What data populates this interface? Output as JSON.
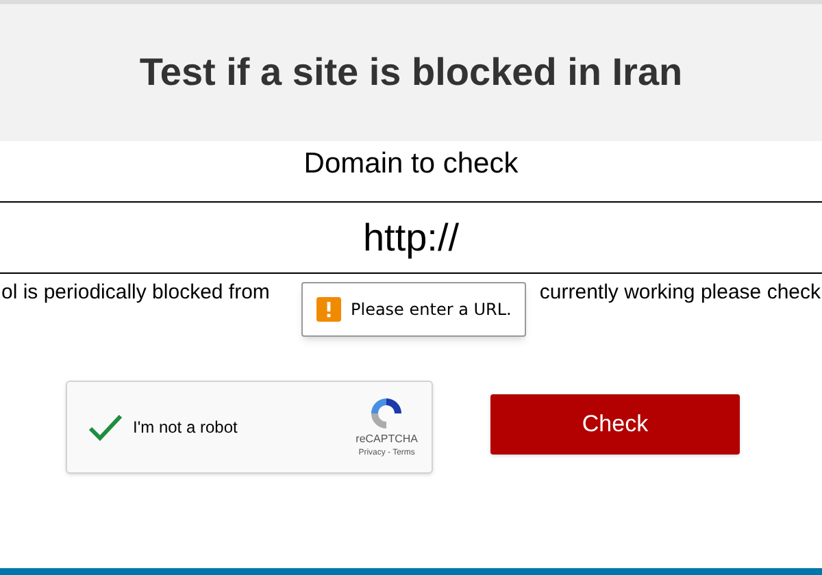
{
  "header": {
    "title": "Test if a site is blocked in Iran"
  },
  "form": {
    "label": "Domain to check",
    "input": {
      "value": "http://"
    }
  },
  "note": {
    "before": "ol is periodically blocked from",
    "after": "currently working please check"
  },
  "tooltip": {
    "text": "Please enter a URL."
  },
  "captcha": {
    "label": "I'm not a robot",
    "checked": true,
    "brand": "reCAPTCHA",
    "links": "Privacy - Terms"
  },
  "check_button": {
    "label": "Check"
  }
}
